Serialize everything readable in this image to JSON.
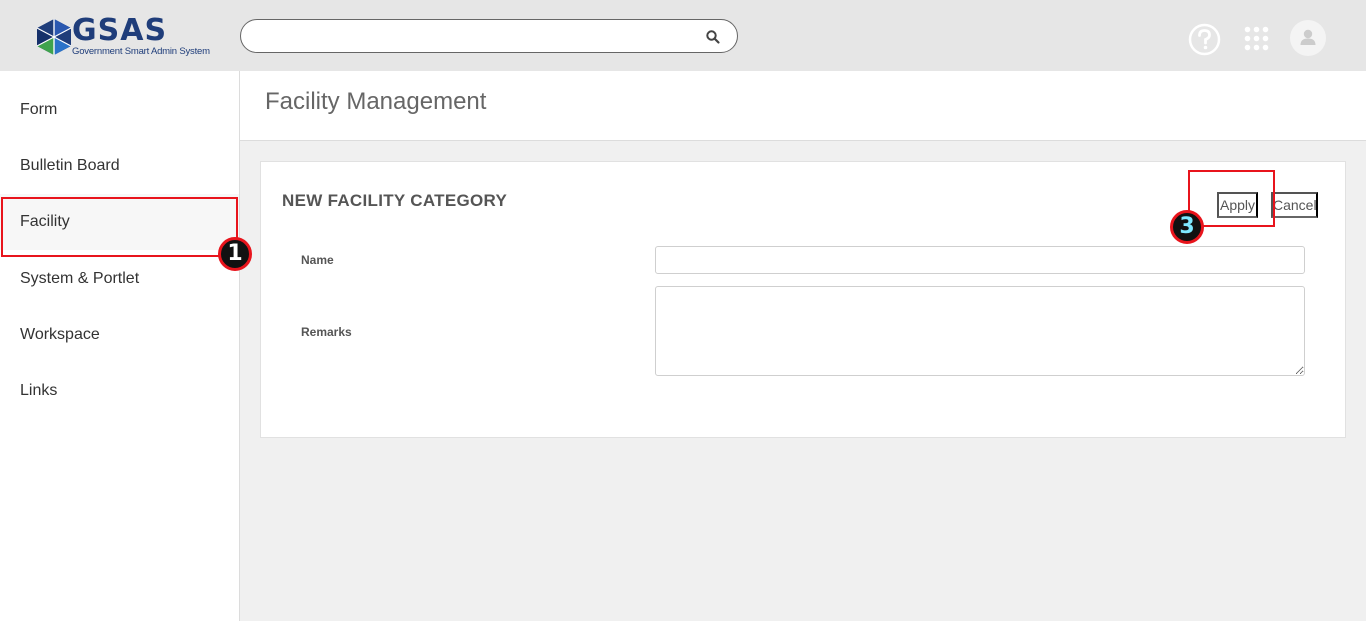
{
  "header": {
    "logo_text": "GSAS",
    "logo_tagline": "Government Smart Admin System",
    "search": {
      "value": "",
      "placeholder": ""
    },
    "icons": [
      "search-icon",
      "help-icon",
      "apps-grid-icon",
      "user-icon"
    ]
  },
  "sidebar": {
    "items": [
      {
        "label": "Form"
      },
      {
        "label": "Bulletin Board"
      },
      {
        "label": "Facility"
      },
      {
        "label": "System & Portlet"
      },
      {
        "label": "Workspace"
      },
      {
        "label": "Links"
      }
    ],
    "active_item": "Facility"
  },
  "page": {
    "title": "Facility Management"
  },
  "form": {
    "title": "NEW FACILITY CATEGORY",
    "apply_label": "Apply",
    "cancel_label": "Cancel",
    "name_label": "Name",
    "name_value": "",
    "remarks_label": "Remarks",
    "remarks_value": ""
  },
  "annotations": {
    "badge_1": "1",
    "badge_3": "3",
    "highlight_color": "#e8141c"
  },
  "colors": {
    "brand_blue": "#1f3d7a",
    "header_bg": "#e6e6e6",
    "content_bg": "#f0f0f0"
  }
}
